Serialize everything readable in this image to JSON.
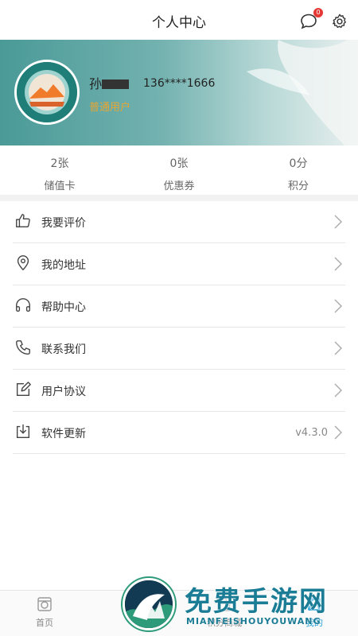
{
  "header": {
    "title": "个人中心",
    "message_badge": "0"
  },
  "profile": {
    "name": "孙",
    "phone": "136****1666",
    "level": "普通用户"
  },
  "stats": [
    {
      "value": "2张",
      "label": "储值卡"
    },
    {
      "value": "0张",
      "label": "优惠券"
    },
    {
      "value": "0分",
      "label": "积分"
    }
  ],
  "menu": [
    {
      "label": "我要评价",
      "icon": "thumbs-up-icon"
    },
    {
      "label": "我的地址",
      "icon": "location-pin-icon"
    },
    {
      "label": "帮助中心",
      "icon": "headphones-icon"
    },
    {
      "label": "联系我们",
      "icon": "phone-icon"
    },
    {
      "label": "用户协议",
      "icon": "edit-icon"
    },
    {
      "label": "软件更新",
      "icon": "download-icon",
      "value": "v4.3.0"
    }
  ],
  "tabbar": [
    {
      "label": "首页",
      "icon": "home-icon"
    },
    {
      "label": "积分商城",
      "icon": "mall-icon"
    },
    {
      "label": "我的",
      "icon": "user-icon",
      "active": true
    }
  ],
  "watermark": {
    "title": "免费手游网",
    "subtitle": "MIANFEISHOUYOUWANG"
  },
  "colors": {
    "accent": "#1f9fd9",
    "level": "#e8a532",
    "banner": "#4a9a98"
  }
}
